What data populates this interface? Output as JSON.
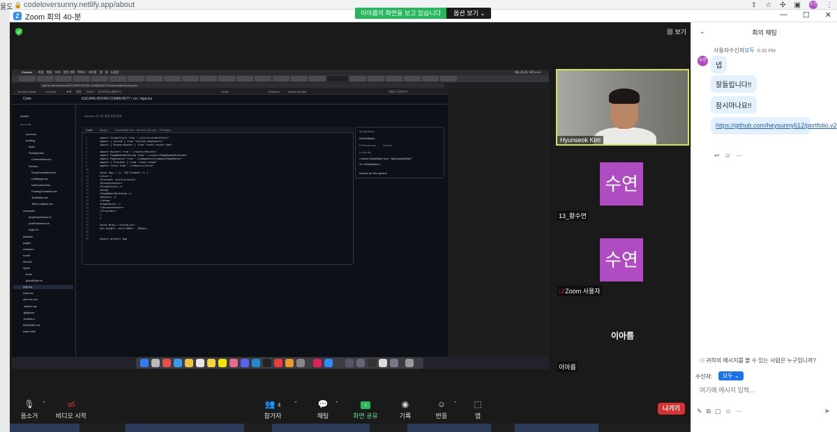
{
  "browser": {
    "url": "codeloversunny.netlify.app/about",
    "left_cut": "물도",
    "avatar": "수연"
  },
  "window": {
    "title": "Zoom 회의 40-분",
    "minimize": "—",
    "maximize": "☐",
    "close": "✕"
  },
  "share_banner": {
    "message": "이아름의 화면을 보고 있습니다",
    "options": "옵션 보기"
  },
  "view_button": "보기",
  "shared_screen": {
    "menubar": [
      "Chrome",
      "파일",
      "편집",
      "보기",
      "방문 기록",
      "북마크",
      "프로필",
      "탭",
      "창",
      "도움말"
    ],
    "menubar_right": "7월 1일 (토) 오후 6:43",
    "url": "github.com/sehreum/ESCAPE-ROOM-COMMUNITY/blob/master/src/App.tsx",
    "bookmarks": [
      "YouTube Music",
      "YouTube",
      "코테",
      "메일",
      "TODO",
      "[티스토리] 새글쓰기",
      "Gmail",
      "Pinterest",
      "Adobe Acrobat",
      "저장소 모아보기"
    ],
    "repo_path": "ESCAPE-ROOM-COMMUNITY / src / App.tsx",
    "code_label": "Code",
    "commit": "sehreum   로그인 관련 설정 변경",
    "tabs": [
      "Code",
      "Blame",
      "Executable File · 36 lines (26 loc) · 712 Bytes"
    ],
    "file_tree": [
      "master",
      "Go to file",
      "common",
      "posting",
      "Main",
      "PostingView",
      "ContentView.tsx",
      "Review",
      "DropDownMenu.tsx",
      "ListBadge.tsx",
      "NullContent.tsx",
      "PostingContainer.tsx",
      "TextEditor.tsx",
      "TitleContainer.tsx",
      "constants",
      "dropDownMenu.ts",
      "postPathname.ts",
      "regex.ts",
      "firebase",
      "pages",
      "reducers",
      "router",
      "service",
      "styles",
      "fonts",
      "globalStyle.ts",
      "App.tsx",
      "main.tsx",
      "vite-env.d.ts",
      ".eslintrc.cjs",
      ".gitignore",
      ".prettierrc",
      "README.md",
      "index.html"
    ],
    "code_lines": [
      "import GlobalStyle from \"./styles/globalStyle\"",
      "import { styled } from \"styled-components\"",
      "import { BrowserRouter } from \"react-router-dom\"",
      "",
      "import Routers from \"./router/Routers\"",
      "import PageModalWithSide from \"./router/PageModalWithSide\"",
      "import PageFooter from \"./components/common/PageFooter\"",
      "import { Provider } from \"react-redux\"",
      "import store from \"./reducers/store\"",
      "",
      "const App = (): JSX.Element => {",
      "  return (",
      "    <Provider store={store}>",
      "      <BrowserRouter>",
      "        <GlobalStyle />",
      "        <Wrap>",
      "          <PageModalWithSide />",
      "          <Routers />",
      "        </Wrap>",
      "        <PageFooter />",
      "      </BrowserRouter>",
      "    </Provider>",
      "  )",
      "}",
      "",
      "const Wrap = styled.div`",
      "  min-height: calc(100vh - 200px);",
      "`",
      "",
      "export default App"
    ],
    "symbols": {
      "header": "All Symbols",
      "symbol": "GlobalStyles",
      "refs": "2 References",
      "search": "Search",
      "in_file": "In this file",
      "ref1": "1  import GlobalStyles from \"./styles/globalStyle\"",
      "ref2": "15  <GlobalStyles />",
      "search_symbol": "Search for this symbol"
    }
  },
  "participants": {
    "self": {
      "name": "Hyunseok Kim"
    },
    "tile1": {
      "avatar": "수연",
      "name": "13_황수연"
    },
    "tile2": {
      "avatar": "수연",
      "name": "Zoom 사용자"
    },
    "tile3": {
      "center_name": "이아름",
      "name": "이아름"
    }
  },
  "toolbar": {
    "mute": "음소거",
    "video": "비디오 시작",
    "participants": "참가자",
    "participant_count": "4",
    "chat": "채팅",
    "share": "화면 공유",
    "record": "기록",
    "reactions": "반응",
    "apps": "앱",
    "leave": "나가기"
  },
  "chat": {
    "title": "회의 채팅",
    "sender": "사용자",
    "to_prefix": "수신자",
    "to_target": "모두",
    "time": "6:30 PM",
    "avatar": "수연",
    "messages": [
      "넵",
      "잘들립니다!!",
      "잠시마나요!!",
      "https://github.com/heysunny612/portfolio.v2"
    ],
    "who_can_see": "귀하의 메시지를 볼 수 있는 사람은 누구입니까?",
    "recipient_label": "수신자:",
    "recipient_value": "모두",
    "input_placeholder": "여기에 메시지 입력..."
  }
}
